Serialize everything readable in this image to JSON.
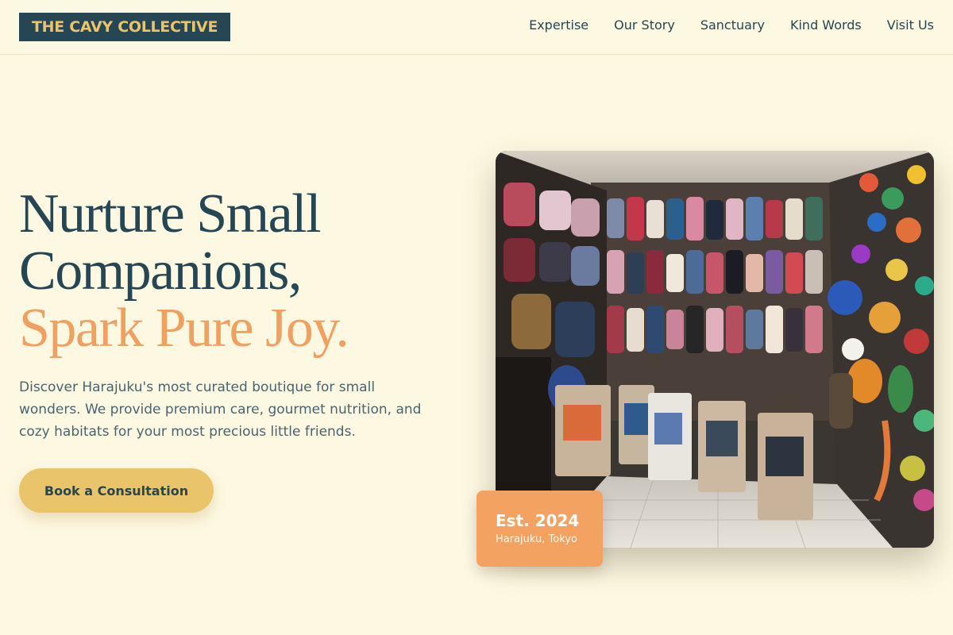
{
  "header": {
    "logo": "THE CAVY COLLECTIVE",
    "nav": [
      "Expertise",
      "Our Story",
      "Sanctuary",
      "Kind Words",
      "Visit Us"
    ]
  },
  "hero": {
    "title_line1": "Nurture Small",
    "title_line2": "Companions,",
    "title_accent": "Spark Pure Joy.",
    "description": "Discover Harajuku's most curated boutique for small wonders. We provide premium care, gourmet nutrition, and cozy habitats for your most precious little friends.",
    "cta_label": "Book a Consultation"
  },
  "badge": {
    "year": "Est. 2024",
    "place": "Harajuku, Tokyo"
  },
  "photo": {
    "subject": "pet-shop-interior-image"
  },
  "colors": {
    "background": "#fdf8e1",
    "navy": "#264653",
    "gold": "#e9c46a",
    "orange": "#f4a261"
  }
}
